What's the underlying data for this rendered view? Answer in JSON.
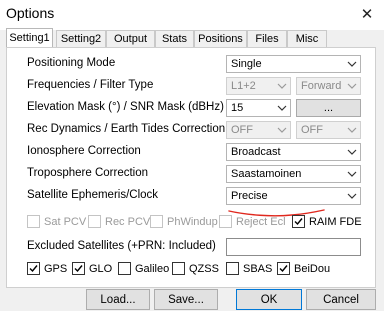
{
  "window": {
    "title": "Options"
  },
  "tabs": [
    "Setting1",
    "Setting2",
    "Output",
    "Stats",
    "Positions",
    "Files",
    "Misc"
  ],
  "rows": {
    "positioning_mode": {
      "label": "Positioning Mode",
      "value": "Single"
    },
    "frequencies": {
      "label": "Frequencies / Filter Type",
      "value1": "L1+2",
      "value2": "Forward"
    },
    "elevation_mask": {
      "label": "Elevation Mask (°) / SNR Mask (dBHz)",
      "value": "15",
      "button": "..."
    },
    "rec_dynamics": {
      "label": "Rec Dynamics / Earth Tides Correction",
      "value1": "OFF",
      "value2": "OFF"
    },
    "ionosphere": {
      "label": "Ionosphere Correction",
      "value": "Broadcast"
    },
    "troposphere": {
      "label": "Troposphere Correction",
      "value": "Saastamoinen"
    },
    "ephemeris": {
      "label": "Satellite Ephemeris/Clock",
      "value": "Precise"
    }
  },
  "options_row": [
    {
      "label": "Sat PCV",
      "checked": false,
      "enabled": false
    },
    {
      "label": "Rec PCV",
      "checked": false,
      "enabled": false
    },
    {
      "label": "PhWindup",
      "checked": false,
      "enabled": false
    },
    {
      "label": "Reject Ecl",
      "checked": false,
      "enabled": false
    },
    {
      "label": "RAIM FDE",
      "checked": true,
      "enabled": true
    }
  ],
  "excluded": {
    "label": "Excluded Satellites (+PRN: Included)",
    "value": ""
  },
  "constellations": [
    {
      "label": "GPS",
      "checked": true
    },
    {
      "label": "GLO",
      "checked": true
    },
    {
      "label": "Galileo",
      "checked": false
    },
    {
      "label": "QZSS",
      "checked": false
    },
    {
      "label": "SBAS",
      "checked": false
    },
    {
      "label": "BeiDou",
      "checked": true
    }
  ],
  "buttons": {
    "load": "Load...",
    "save": "Save...",
    "ok": "OK",
    "cancel": "Cancel"
  },
  "colors": {
    "annotation": "#e0281e",
    "focus": "#0078d7"
  }
}
